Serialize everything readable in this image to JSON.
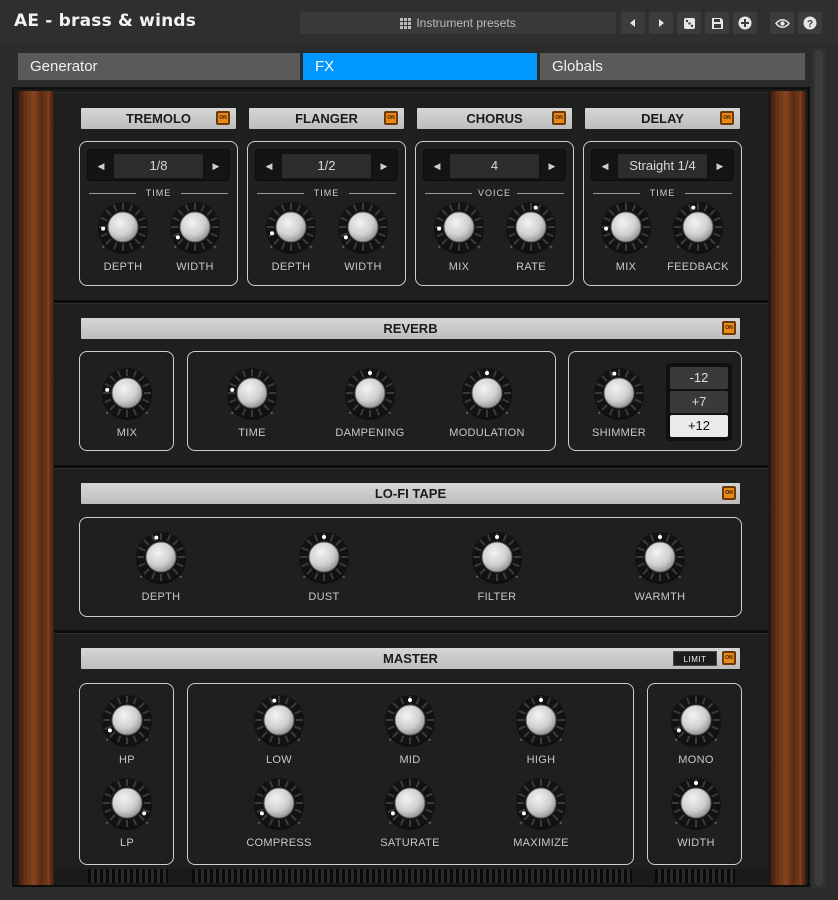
{
  "app": {
    "title": "AE - brass & winds",
    "preset_label": "Instrument presets"
  },
  "toolbar": {
    "prev": "previous-preset",
    "next": "next-preset",
    "random": "randomize",
    "save": "save",
    "add": "add",
    "view": "view",
    "help": "help"
  },
  "tabs": [
    {
      "label": "Generator",
      "active": false
    },
    {
      "label": "FX",
      "active": true
    },
    {
      "label": "Globals",
      "active": false
    }
  ],
  "fx": {
    "tremolo": {
      "title": "TREMOLO",
      "selector_value": "1/8",
      "section_label": "TIME",
      "knobs": [
        {
          "label": "DEPTH",
          "value": 0.15
        },
        {
          "label": "WIDTH",
          "value": 0.05
        }
      ]
    },
    "flanger": {
      "title": "FLANGER",
      "selector_value": "1/2",
      "section_label": "TIME",
      "knobs": [
        {
          "label": "DEPTH",
          "value": 0.1
        },
        {
          "label": "WIDTH",
          "value": 0.05
        }
      ]
    },
    "chorus": {
      "title": "CHORUS",
      "selector_value": "4",
      "section_label": "VOICE",
      "knobs": [
        {
          "label": "MIX",
          "value": 0.15
        },
        {
          "label": "RATE",
          "value": 0.55
        }
      ]
    },
    "delay": {
      "title": "DELAY",
      "selector_value": "Straight 1/4",
      "section_label": "TIME",
      "knobs": [
        {
          "label": "MIX",
          "value": 0.15
        },
        {
          "label": "FEEDBACK",
          "value": 0.45
        }
      ]
    }
  },
  "reverb": {
    "title": "REVERB",
    "knobs": [
      {
        "label": "MIX",
        "value": 0.2
      },
      {
        "label": "TIME",
        "value": 0.2
      },
      {
        "label": "DAMPENING",
        "value": 0.5
      },
      {
        "label": "MODULATION",
        "value": 0.5
      },
      {
        "label": "SHIMMER",
        "value": 0.45
      }
    ],
    "shimmer_options": [
      "-12",
      "+7",
      "+12"
    ],
    "shimmer_selected": "+12"
  },
  "lofi": {
    "title": "LO-FI TAPE",
    "knobs": [
      {
        "label": "DEPTH",
        "value": 0.45
      },
      {
        "label": "DUST",
        "value": 0.5
      },
      {
        "label": "FILTER",
        "value": 0.5
      },
      {
        "label": "WARMTH",
        "value": 0.5
      }
    ]
  },
  "master": {
    "title": "MASTER",
    "limit_label": "LIMIT",
    "knobs": [
      {
        "label": "HP",
        "value": 0.05
      },
      {
        "label": "LP",
        "value": 0.95
      },
      {
        "label": "LOW",
        "value": 0.45
      },
      {
        "label": "MID",
        "value": 0.5
      },
      {
        "label": "HIGH",
        "value": 0.5
      },
      {
        "label": "COMPRESS",
        "value": 0.05
      },
      {
        "label": "SATURATE",
        "value": 0.05
      },
      {
        "label": "MAXIMIZE",
        "value": 0.05
      },
      {
        "label": "MONO",
        "value": 0.05
      },
      {
        "label": "WIDTH",
        "value": 0.5
      }
    ]
  },
  "on_label": "ON"
}
